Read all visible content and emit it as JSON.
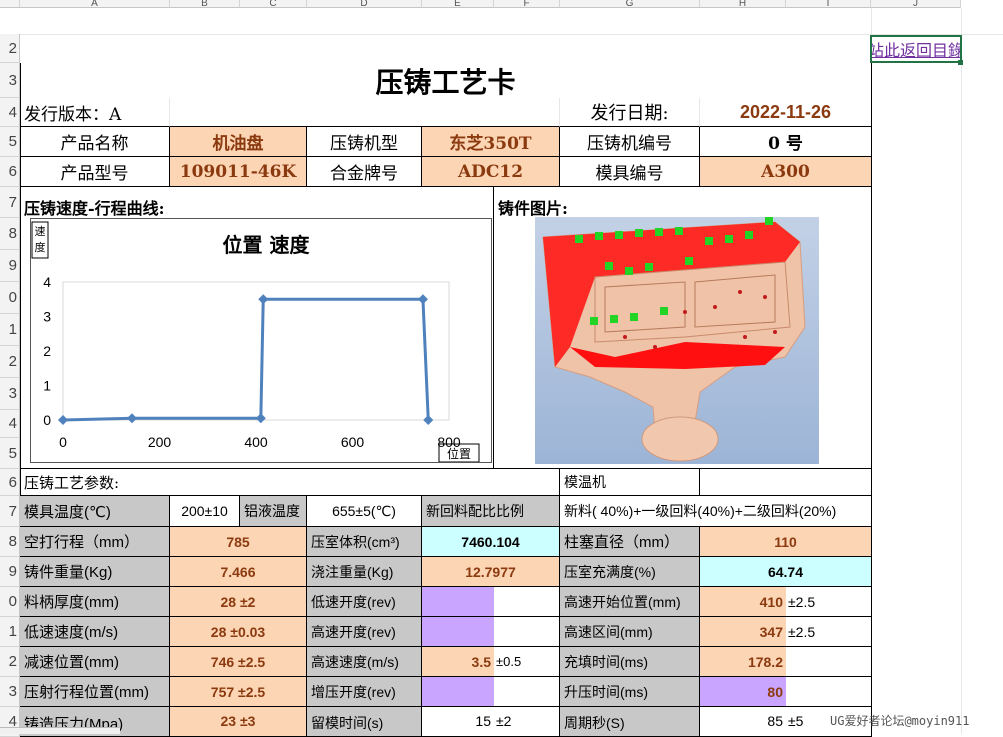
{
  "columns": [
    "A",
    "B",
    "C",
    "D",
    "E",
    "F",
    "G",
    "H",
    "I",
    "J"
  ],
  "rows": [
    "2",
    "3",
    "4",
    "5",
    "6",
    "7",
    "8",
    "9",
    "0",
    "1",
    "2",
    "3",
    "4",
    "5",
    "6",
    "7",
    "8",
    "9",
    "0",
    "1",
    "2",
    "3",
    "4"
  ],
  "link": "站此返回目錄",
  "title": "压铸工艺卡",
  "version_label": "发行版本：A",
  "date_label": "发行日期:",
  "date_value": "2022-11-26",
  "info": {
    "r1": [
      "产品名称",
      "机油盘",
      "压铸机型",
      "东芝350T",
      "压铸机编号",
      "0 号"
    ],
    "r2": [
      "产品型号",
      "109011-46K",
      "合金牌号",
      "ADC12",
      "模具编号",
      "A300"
    ]
  },
  "sections": {
    "curve": "压铸速度-行程曲线:",
    "photo": "铸件图片:",
    "params": "压铸工艺参数:",
    "mold_heater": "模温机"
  },
  "chart_data": {
    "type": "line",
    "title": "位置 速度",
    "ylabel": "速度",
    "xlabel": "位置",
    "xlim": [
      0,
      800
    ],
    "ylim": [
      0,
      4
    ],
    "xticks": [
      "0",
      "200",
      "400",
      "600",
      "800"
    ],
    "yticks": [
      "0",
      "1",
      "2",
      "3",
      "4"
    ],
    "series": [
      {
        "x": [
          0,
          143,
          410,
          415,
          746,
          757
        ],
        "y": [
          0,
          0.05,
          0.05,
          3.5,
          3.5,
          0
        ]
      }
    ],
    "color": "#4f81bd"
  },
  "params": {
    "r17": [
      "模具温度(℃)",
      "200±10",
      "铝液温度",
      "655±5(℃)",
      "新回料配比比例",
      "新料( 40%)+一级回料(40%)+二级回料(20%)"
    ],
    "r18": [
      "空打行程（mm）",
      "785",
      "压室体积(cm³)",
      "7460.104",
      "柱塞直径（mm）",
      "110"
    ],
    "r19": [
      "铸件重量(Kg)",
      "7.466",
      "浇注重量(Kg)",
      "12.7977",
      "压室充满度(%)",
      "64.74"
    ],
    "r20": [
      "料柄厚度(mm)",
      "28",
      "±2",
      "低速开度(rev)",
      "高速开始位置(mm)",
      "410",
      "±2.5"
    ],
    "r21": [
      "低速速度(m/s)",
      "28",
      "±0.03",
      "高速开度(rev)",
      "高速区间(mm)",
      "347",
      "±2.5"
    ],
    "r22": [
      "减速位置(mm)",
      "746",
      "±2.5",
      "高速速度(m/s)",
      "3.5",
      "±0.5",
      "充填时间(ms)",
      "178.2"
    ],
    "r23": [
      "压射行程位置(mm)",
      "757",
      "±2.5",
      "增压开度(rev)",
      "升压时间(ms)",
      "80"
    ],
    "r24": [
      "铸造压力(Mpa)",
      "23",
      "±3",
      "留模时间(s)",
      "15",
      "±2",
      "周期秒(S)",
      "85",
      "±5"
    ]
  },
  "watermark": "UG爱好者论坛@moyin911",
  "colors": {
    "peach": "#fcd5b4",
    "gray": "#c8c8c8",
    "cyan": "#ccffff",
    "purple": "#c9a5ff",
    "brown": "#8b3a0f"
  }
}
